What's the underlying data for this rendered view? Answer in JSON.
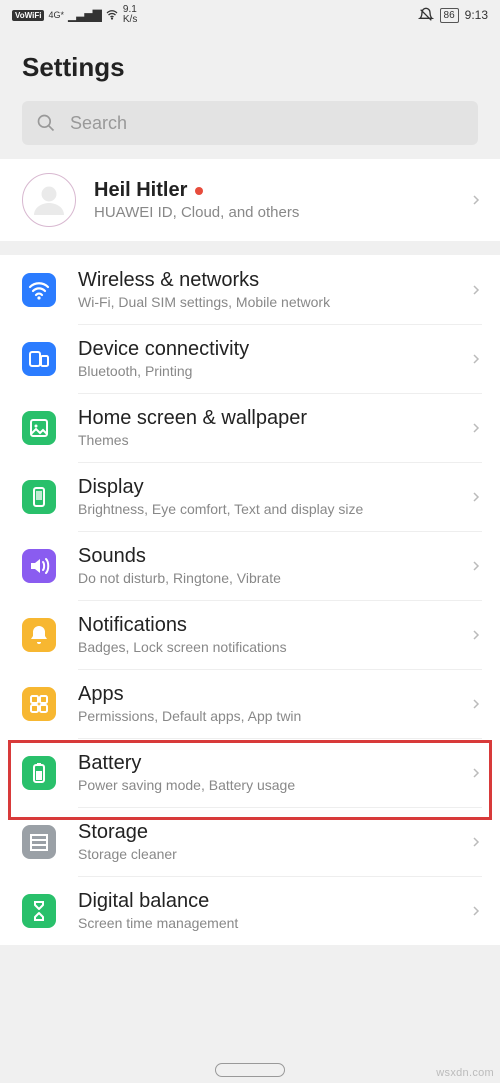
{
  "status": {
    "vowifi": "VoWiFi",
    "network": "4G*",
    "speed_top": "9.1",
    "speed_bot": "K/s",
    "battery": "86",
    "time": "9:13"
  },
  "title": "Settings",
  "search": {
    "placeholder": "Search"
  },
  "account": {
    "name": "Heil Hitler",
    "sub": "HUAWEI ID, Cloud, and others"
  },
  "items": [
    {
      "id": "wireless",
      "title": "Wireless & networks",
      "sub": "Wi-Fi, Dual SIM settings, Mobile network",
      "color": "#2b7cff",
      "icon": "wifi"
    },
    {
      "id": "device",
      "title": "Device connectivity",
      "sub": "Bluetooth, Printing",
      "color": "#2b7cff",
      "icon": "devices"
    },
    {
      "id": "home",
      "title": "Home screen & wallpaper",
      "sub": "Themes",
      "color": "#29c06b",
      "icon": "image"
    },
    {
      "id": "display",
      "title": "Display",
      "sub": "Brightness, Eye comfort, Text and display size",
      "color": "#29c06b",
      "icon": "phone"
    },
    {
      "id": "sounds",
      "title": "Sounds",
      "sub": "Do not disturb, Ringtone, Vibrate",
      "color": "#8a5cf0",
      "icon": "sound"
    },
    {
      "id": "notifications",
      "title": "Notifications",
      "sub": "Badges, Lock screen notifications",
      "color": "#f7b731",
      "icon": "bell"
    },
    {
      "id": "apps",
      "title": "Apps",
      "sub": "Permissions, Default apps, App twin",
      "color": "#f7b731",
      "icon": "grid"
    },
    {
      "id": "battery",
      "title": "Battery",
      "sub": "Power saving mode, Battery usage",
      "color": "#29c06b",
      "icon": "battery"
    },
    {
      "id": "storage",
      "title": "Storage",
      "sub": "Storage cleaner",
      "color": "#9aa0a6",
      "icon": "storage"
    },
    {
      "id": "digital",
      "title": "Digital balance",
      "sub": "Screen time management",
      "color": "#29c06b",
      "icon": "hourglass"
    }
  ],
  "watermark": "wsxdn.com"
}
